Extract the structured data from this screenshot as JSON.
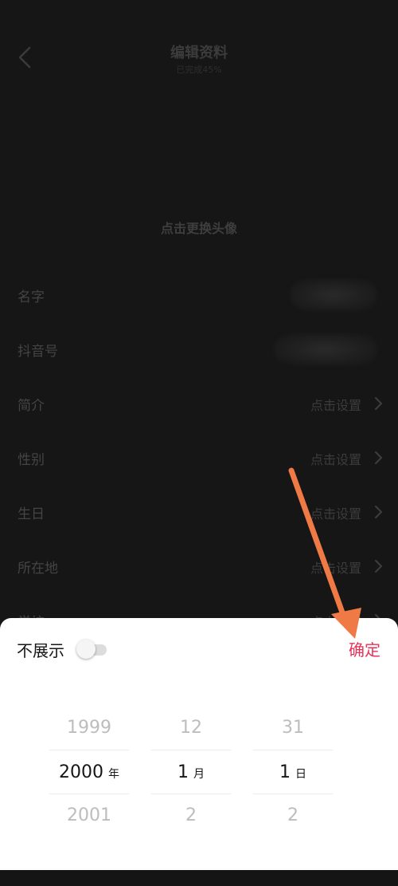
{
  "header": {
    "title": "编辑资料",
    "subtitle": "已完成45%"
  },
  "avatar": {
    "hint": "点击更换头像"
  },
  "profile_rows": [
    {
      "label": "名字",
      "value": ""
    },
    {
      "label": "抖音号",
      "value": ""
    },
    {
      "label": "简介",
      "value": "点击设置"
    },
    {
      "label": "性别",
      "value": "点击设置"
    },
    {
      "label": "生日",
      "value": "点击设置"
    },
    {
      "label": "所在地",
      "value": "点击设置"
    },
    {
      "label": "学校",
      "value": "点击设置"
    }
  ],
  "date_picker": {
    "hide_label": "不展示",
    "hide_toggle_on": false,
    "confirm_label": "确定",
    "year": {
      "prev": "1999",
      "selected": "2000",
      "unit": "年",
      "next": "2001"
    },
    "month": {
      "prev": "12",
      "selected": "1",
      "unit": "月",
      "next": "2"
    },
    "day": {
      "prev": "31",
      "selected": "1",
      "unit": "日",
      "next": "2"
    }
  },
  "colors": {
    "background": "#161616",
    "accent": "#e4345a",
    "annotation_arrow": "#f07a45"
  },
  "icons": {
    "back": "chevron-left-icon",
    "row_chevron": "chevron-right-icon",
    "annotation": "arrow-down-right-icon"
  }
}
